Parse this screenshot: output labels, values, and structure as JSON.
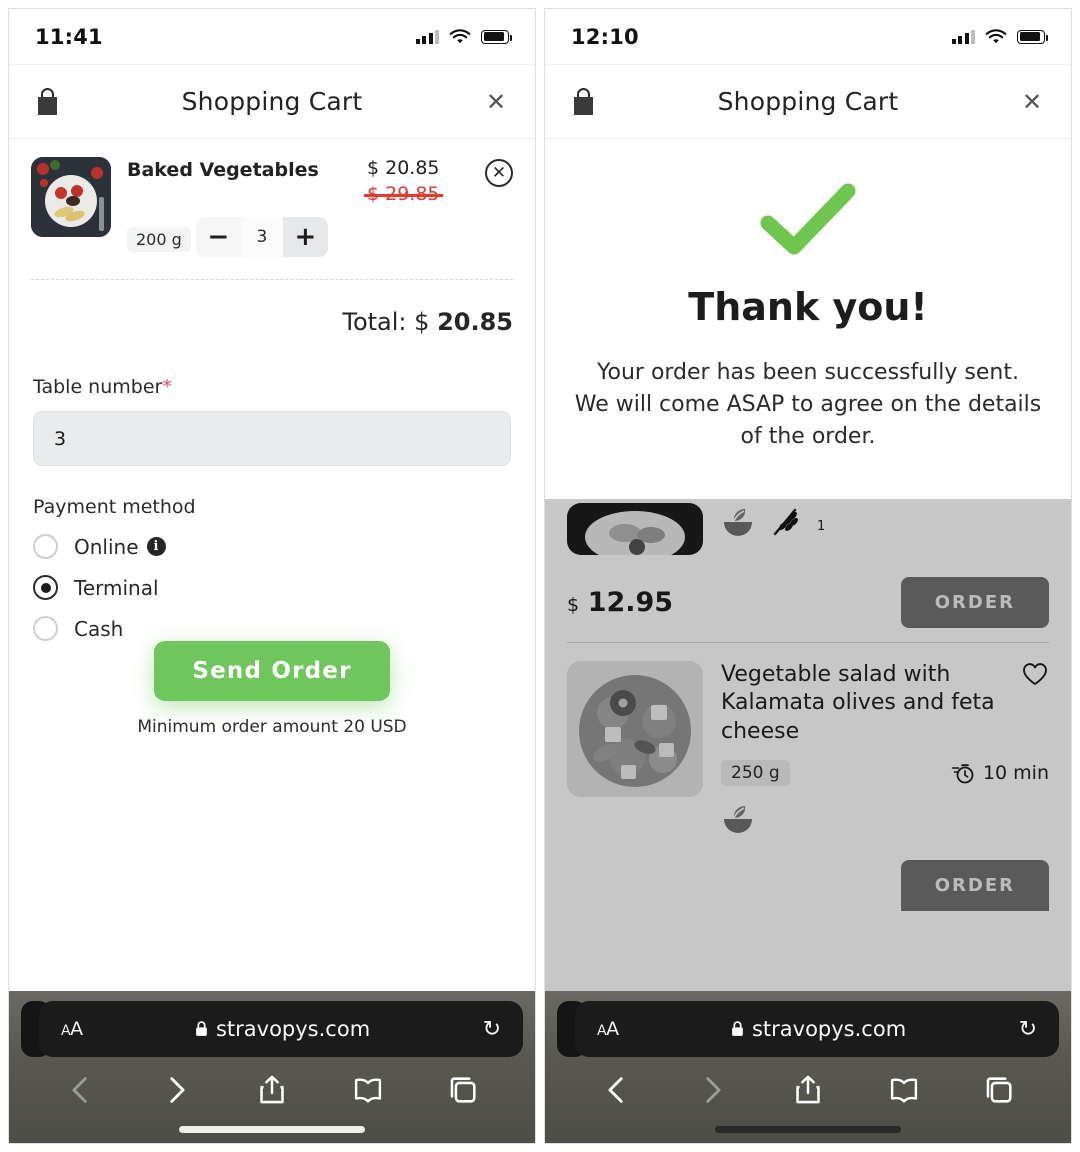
{
  "left_phone": {
    "status_bar": {
      "time": "11:41",
      "signal_icon": "cellular-signal-icon",
      "wifi_icon": "wifi-icon",
      "battery_icon": "battery-icon"
    },
    "app_header": {
      "bag_icon": "shopping-bag-icon",
      "title": "Shopping Cart",
      "close_icon": "close-icon"
    },
    "cart_item": {
      "name": "Baked Vegetables",
      "weight": "200 g",
      "price_current": "$ 20.85",
      "price_old": "$ 29.85",
      "quantity": "3",
      "minus_label": "−",
      "plus_label": "+",
      "remove_icon": "remove-circle-icon",
      "thumbnail_alt": "baked-vegetables-photo"
    },
    "total": {
      "label": "Total:",
      "currency": "$",
      "amount": "20.85"
    },
    "form": {
      "table_number_label": "Table number",
      "required_mark": "*",
      "table_number_value": "3",
      "payment_title": "Payment method",
      "payment_options": [
        {
          "label": "Online",
          "selected": false,
          "info_icon": "info-icon",
          "info_glyph": "i"
        },
        {
          "label": "Terminal",
          "selected": true
        },
        {
          "label": "Cash",
          "selected": false
        }
      ]
    },
    "cta": {
      "send_label": "Send Order",
      "minimum_note": "Minimum order amount 20 USD"
    },
    "safari": {
      "aa_label_small": "A",
      "aa_label_large": "A",
      "lock_icon": "lock-icon",
      "url": "stravopys.com",
      "reload_icon": "reload-icon",
      "back_icon": "back-chevron-icon",
      "forward_icon": "forward-chevron-icon",
      "share_icon": "share-icon",
      "bookmarks_icon": "bookmarks-icon",
      "tabs_icon": "tabs-icon"
    }
  },
  "right_phone": {
    "status_bar": {
      "time": "12:10",
      "signal_icon": "cellular-signal-icon",
      "wifi_icon": "wifi-icon",
      "battery_icon": "battery-icon"
    },
    "app_header": {
      "bag_icon": "shopping-bag-icon",
      "title": "Shopping Cart",
      "close_icon": "close-icon"
    },
    "thanks": {
      "check_icon": "success-check-icon",
      "title": "Thank you!",
      "line1": "Your order has been successfully sent.",
      "line2": "We will come ASAP to agree on the details",
      "line3": "of the order."
    },
    "menu_items": [
      {
        "partial": true,
        "thumbnail_alt": "soup-bowl-photo",
        "badges": [
          "vegan-bowl-icon",
          "gluten-wheat-icon"
        ],
        "badge_number": "1",
        "price_currency": "$",
        "price_amount": "12.95",
        "order_label": "ORDER"
      },
      {
        "partial": false,
        "thumbnail_alt": "vegetable-salad-photo",
        "title": "Vegetable salad with Kalamata olives and feta cheese",
        "favorite_icon": "heart-icon",
        "weight": "250 g",
        "time_icon": "cooking-time-icon",
        "time": "10 min",
        "badges": [
          "vegan-bowl-icon"
        ],
        "order_label": "ORDER"
      }
    ],
    "safari": {
      "aa_label_small": "A",
      "aa_label_large": "A",
      "lock_icon": "lock-icon",
      "url": "stravopys.com",
      "reload_icon": "reload-icon",
      "back_icon": "back-chevron-icon",
      "forward_icon": "forward-chevron-icon",
      "share_icon": "share-icon",
      "bookmarks_icon": "bookmarks-icon",
      "tabs_icon": "tabs-icon"
    }
  },
  "colors": {
    "green_primary": "#6ec65c",
    "green_dark": "#3f8a35",
    "red_strike": "#e8392c",
    "required_pink": "#e0487a",
    "text_dark": "#232323"
  }
}
